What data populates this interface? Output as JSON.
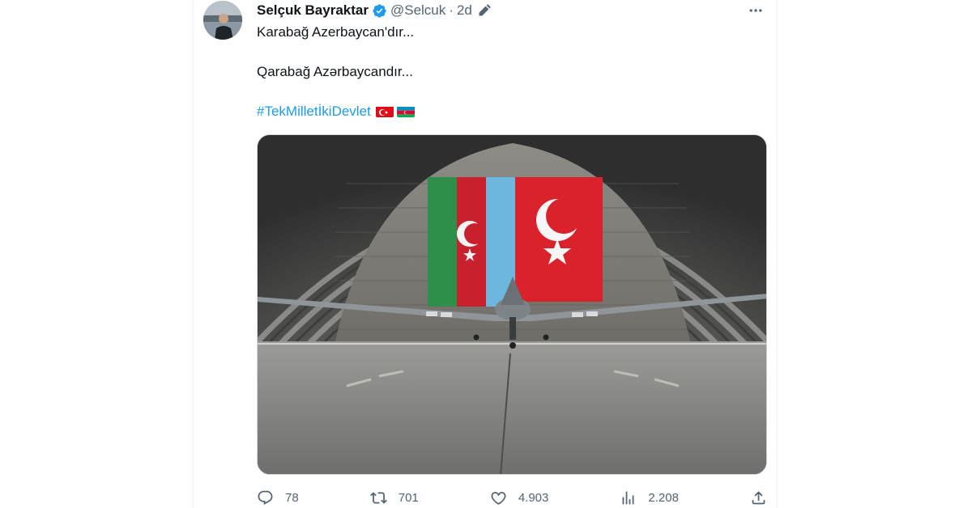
{
  "author": {
    "name": "Selçuk Bayraktar",
    "handle": "@Selcuk",
    "separator": "·",
    "time": "2d"
  },
  "tweet": {
    "line1": "Karabağ Azerbaycan'dır...",
    "line2": "Qarabağ Azərbaycandır...",
    "hashtag": "#TekMilletİkiDevlet"
  },
  "metrics": {
    "replies": "78",
    "retweets": "701",
    "likes": "4.903",
    "views": "2.208"
  },
  "colors": {
    "accent": "#1d9bf0",
    "text": "#0f1419",
    "secondary": "#536471",
    "turkey_red": "#e30a17",
    "azerbaijan_blue": "#0092bc",
    "azerbaijan_red": "#e4002b",
    "azerbaijan_green": "#00af50"
  },
  "icons": {
    "verified": "verified-badge-icon",
    "edited": "edit-pencil-icon",
    "more": "more-dots-icon",
    "reply": "reply-icon",
    "retweet": "retweet-icon",
    "like": "heart-icon",
    "views": "views-bars-icon",
    "share": "share-icon"
  }
}
